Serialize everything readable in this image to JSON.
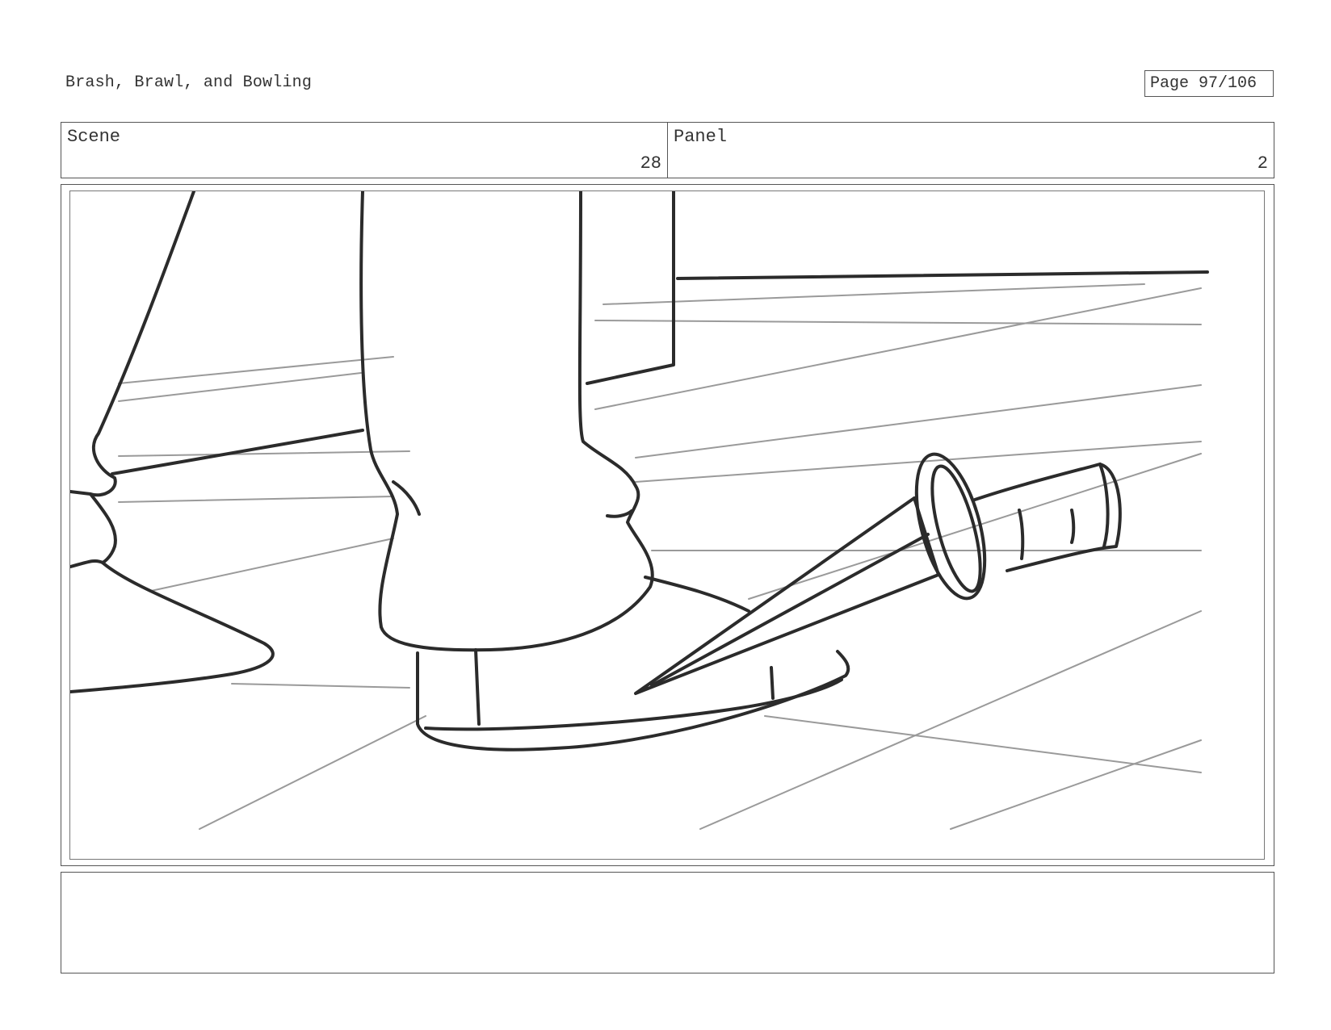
{
  "document": {
    "title": "Brash, Brawl, and Bowling",
    "page_label": "Page",
    "page_number": "97/106"
  },
  "scene": {
    "label": "Scene",
    "value": "28"
  },
  "panel": {
    "label": "Panel",
    "value": "2"
  },
  "notes": {
    "text": ""
  },
  "artwork": {
    "icon": "storyboard-sketch-foot-and-dagger",
    "line_color": "#2b2b2b",
    "guide_color": "#9a9a9a"
  }
}
